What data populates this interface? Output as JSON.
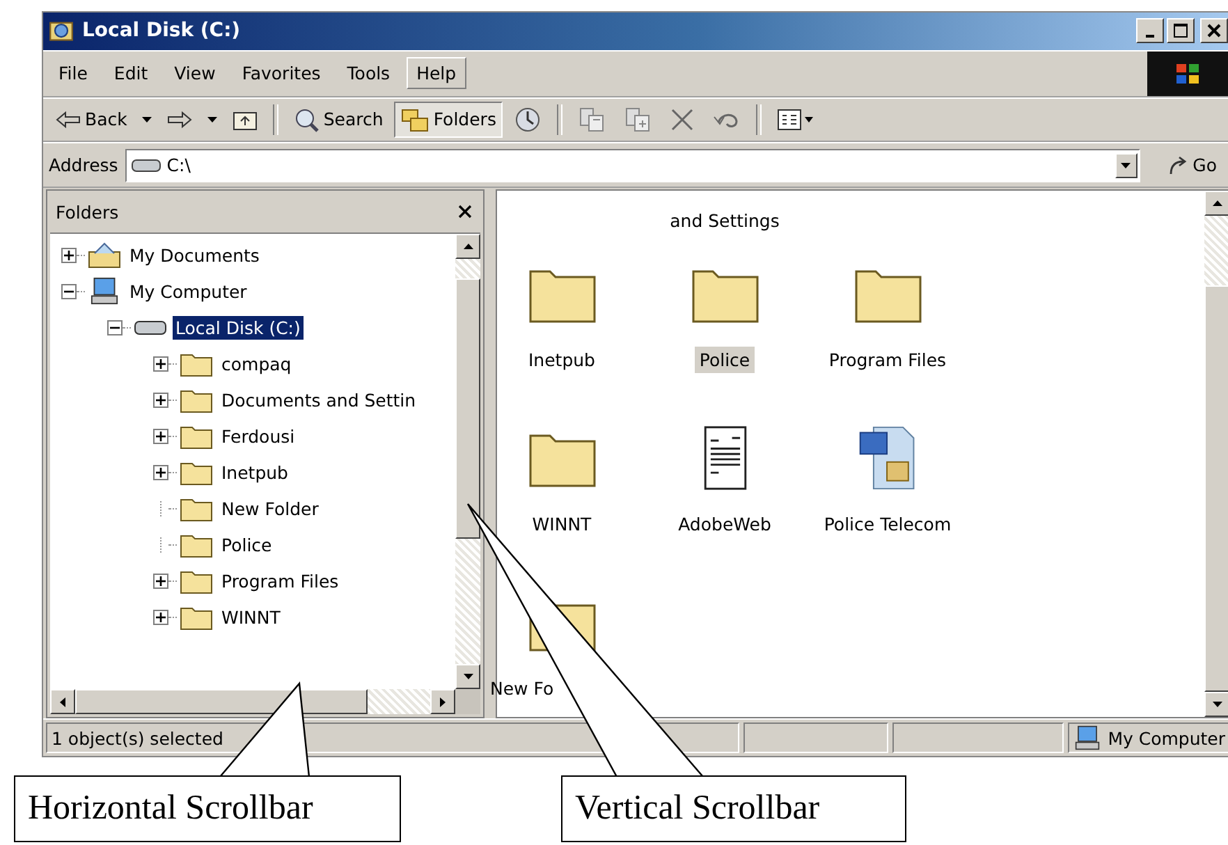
{
  "window": {
    "title": "Local Disk (C:)"
  },
  "menu": [
    {
      "label": "File",
      "highlighted": false
    },
    {
      "label": "Edit",
      "highlighted": false
    },
    {
      "label": "View",
      "highlighted": false
    },
    {
      "label": "Favorites",
      "highlighted": false
    },
    {
      "label": "Tools",
      "highlighted": false
    },
    {
      "label": "Help",
      "highlighted": true
    }
  ],
  "toolbar": [
    {
      "kind": "back",
      "label": "Back",
      "pressed": false
    },
    {
      "kind": "dropdown",
      "pressed": false
    },
    {
      "kind": "forward",
      "pressed": false
    },
    {
      "kind": "dropdown",
      "pressed": false
    },
    {
      "kind": "up",
      "pressed": false
    },
    {
      "kind": "separator"
    },
    {
      "kind": "search",
      "label": "Search",
      "pressed": false
    },
    {
      "kind": "folders",
      "label": "Folders",
      "pressed": true
    },
    {
      "kind": "history",
      "pressed": false
    },
    {
      "kind": "separator"
    },
    {
      "kind": "move",
      "pressed": false
    },
    {
      "kind": "copy",
      "pressed": false
    },
    {
      "kind": "delete",
      "pressed": false
    },
    {
      "kind": "undo",
      "pressed": false
    },
    {
      "kind": "separator"
    },
    {
      "kind": "views",
      "pressed": false
    }
  ],
  "address": {
    "label": "Address",
    "value": "C:\\",
    "go": "Go"
  },
  "folders_pane": {
    "title": "Folders"
  },
  "tree": [
    {
      "label": "My Documents",
      "kind": "documents",
      "expanded": false,
      "selected": false
    },
    {
      "label": "My Computer",
      "kind": "computer",
      "expanded": true,
      "selected": false,
      "children": [
        {
          "label": "Local Disk (C:)",
          "kind": "drive",
          "expanded": true,
          "selected": true,
          "children": [
            {
              "label": "compaq",
              "kind": "folder",
              "expanded": false,
              "selected": false
            },
            {
              "label": "Documents and Settin",
              "kind": "folder",
              "expanded": false,
              "selected": false
            },
            {
              "label": "Ferdousi",
              "kind": "folder",
              "expanded": false,
              "selected": false
            },
            {
              "label": "Inetpub",
              "kind": "folder",
              "expanded": false,
              "selected": false
            },
            {
              "label": "New Folder",
              "kind": "folder",
              "selected": false
            },
            {
              "label": "Police",
              "kind": "folder",
              "selected": false
            },
            {
              "label": "Program Files",
              "kind": "folder",
              "expanded": false,
              "selected": false
            },
            {
              "label": "WINNT",
              "kind": "folder",
              "expanded": false,
              "selected": false
            }
          ]
        }
      ]
    }
  ],
  "content": {
    "partial_label": "and Settings",
    "items": [
      {
        "label": "Inetpub",
        "kind": "folder",
        "selected": false
      },
      {
        "label": "Police",
        "kind": "folder",
        "selected": true
      },
      {
        "label": "Program Files",
        "kind": "folder",
        "selected": false
      },
      {
        "label": "WINNT",
        "kind": "folder",
        "selected": false
      },
      {
        "label": "AdobeWeb",
        "kind": "text-document",
        "selected": false
      },
      {
        "label": "Police Telecom",
        "kind": "word-document",
        "selected": false
      },
      {
        "label": "New Fo",
        "kind": "folder",
        "selected": false
      }
    ]
  },
  "status_bar": {
    "message": "1 object(s) selected",
    "zone": "My Computer"
  },
  "callouts": [
    {
      "label": "Horizontal Scrollbar"
    },
    {
      "label": "Vertical Scrollbar"
    }
  ]
}
